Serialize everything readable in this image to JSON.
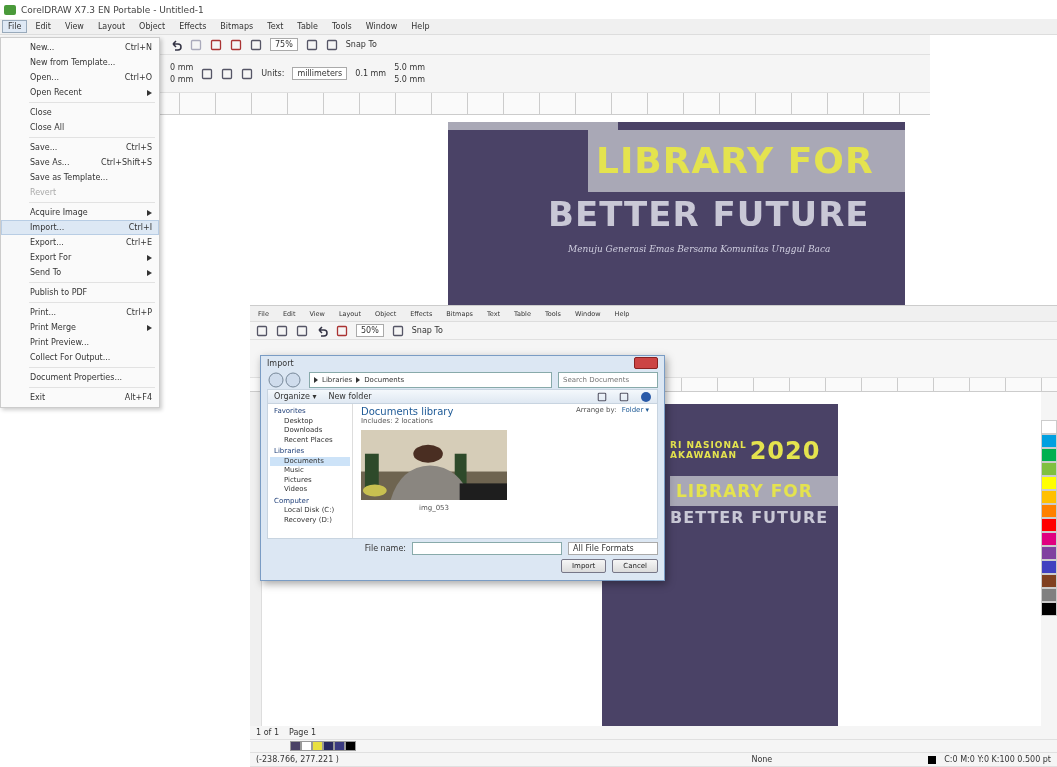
{
  "back_window": {
    "title": "CorelDRAW X7.3 EN Portable - Untitled-1",
    "menu": [
      {
        "label": "File",
        "selected": true
      },
      {
        "label": "Edit",
        "selected": false
      },
      {
        "label": "View",
        "selected": false
      },
      {
        "label": "Layout",
        "selected": false
      },
      {
        "label": "Object",
        "selected": false
      },
      {
        "label": "Effects",
        "selected": false
      },
      {
        "label": "Bitmaps",
        "selected": false
      },
      {
        "label": "Text",
        "selected": false
      },
      {
        "label": "Table",
        "selected": false
      },
      {
        "label": "Tools",
        "selected": false
      },
      {
        "label": "Window",
        "selected": false
      },
      {
        "label": "Help",
        "selected": false
      }
    ],
    "zoom": "75%",
    "snap": "Snap To",
    "width_field": "0 mm",
    "height_field": "0 mm",
    "units_label": "Units:",
    "units": "millimeters",
    "nudge": "0.1 mm",
    "dup_x": "5.0 mm",
    "dup_y": "5.0 mm",
    "poster": {
      "line_1": "LIBRARY FOR",
      "line_2": "BETTER FUTURE",
      "tagline": "Menuju Generasi Emas Bersama Komunitas Unggul Baca"
    }
  },
  "file_menu": {
    "sections": [
      {
        "items": [
          {
            "label": "New...",
            "shortcut": "Ctrl+N",
            "submenu": false,
            "disabled": false,
            "selected": false
          },
          {
            "label": "New from Template...",
            "submenu": false,
            "disabled": false,
            "selected": false
          },
          {
            "label": "Open...",
            "shortcut": "Ctrl+O",
            "submenu": false,
            "disabled": false,
            "selected": false
          },
          {
            "label": "Open Recent",
            "submenu": true,
            "disabled": false,
            "selected": false
          }
        ]
      },
      {
        "items": [
          {
            "label": "Close",
            "submenu": false,
            "disabled": false,
            "selected": false
          },
          {
            "label": "Close All",
            "submenu": false,
            "disabled": false,
            "selected": false
          }
        ]
      },
      {
        "items": [
          {
            "label": "Save...",
            "shortcut": "Ctrl+S",
            "submenu": false,
            "disabled": false,
            "selected": false
          },
          {
            "label": "Save As...",
            "shortcut": "Ctrl+Shift+S",
            "submenu": false,
            "disabled": false,
            "selected": false
          },
          {
            "label": "Save as Template...",
            "submenu": false,
            "disabled": false,
            "selected": false
          },
          {
            "label": "Revert",
            "submenu": false,
            "disabled": true,
            "selected": false
          }
        ]
      },
      {
        "items": [
          {
            "label": "Acquire Image",
            "submenu": true,
            "disabled": false,
            "selected": false
          },
          {
            "label": "Import...",
            "shortcut": "Ctrl+I",
            "submenu": false,
            "disabled": false,
            "selected": true
          },
          {
            "label": "Export...",
            "shortcut": "Ctrl+E",
            "submenu": false,
            "disabled": false,
            "selected": false
          },
          {
            "label": "Export For",
            "submenu": true,
            "disabled": false,
            "selected": false
          },
          {
            "label": "Send To",
            "submenu": true,
            "disabled": false,
            "selected": false
          }
        ]
      },
      {
        "items": [
          {
            "label": "Publish to PDF",
            "submenu": false,
            "disabled": false,
            "selected": false
          }
        ]
      },
      {
        "items": [
          {
            "label": "Print...",
            "shortcut": "Ctrl+P",
            "submenu": false,
            "disabled": false,
            "selected": false
          },
          {
            "label": "Print Merge",
            "submenu": true,
            "disabled": false,
            "selected": false
          },
          {
            "label": "Print Preview...",
            "submenu": false,
            "disabled": false,
            "selected": false
          },
          {
            "label": "Collect For Output...",
            "submenu": false,
            "disabled": false,
            "selected": false
          }
        ]
      },
      {
        "items": [
          {
            "label": "Document Properties...",
            "submenu": false,
            "disabled": false,
            "selected": false
          }
        ]
      },
      {
        "items": [
          {
            "label": "Exit",
            "shortcut": "Alt+F4",
            "submenu": false,
            "disabled": false,
            "selected": false
          }
        ]
      }
    ]
  },
  "front_window": {
    "menu": [
      {
        "label": "File",
        "selected": false
      },
      {
        "label": "Edit",
        "selected": false
      },
      {
        "label": "View",
        "selected": false
      },
      {
        "label": "Layout",
        "selected": false
      },
      {
        "label": "Object",
        "selected": false
      },
      {
        "label": "Effects",
        "selected": false
      },
      {
        "label": "Bitmaps",
        "selected": false
      },
      {
        "label": "Text",
        "selected": false
      },
      {
        "label": "Table",
        "selected": false
      },
      {
        "label": "Tools",
        "selected": false
      },
      {
        "label": "Window",
        "selected": false
      },
      {
        "label": "Help",
        "selected": false
      }
    ],
    "zoom": "50%",
    "snap": "Snap To",
    "poster": {
      "line_1": "RI NASIONAL",
      "line_2": "AKAWANAN",
      "year": "2020",
      "line_3": "LIBRARY FOR",
      "line_4": "BETTER FUTURE"
    },
    "palette": [
      {
        "color": "#ffffff"
      },
      {
        "color": "#00a0e0"
      },
      {
        "color": "#00b050"
      },
      {
        "color": "#80c040"
      },
      {
        "color": "#ffff00"
      },
      {
        "color": "#ffc000"
      },
      {
        "color": "#ff8000"
      },
      {
        "color": "#ff0000"
      },
      {
        "color": "#e00080"
      },
      {
        "color": "#8040a0"
      },
      {
        "color": "#4040c0"
      },
      {
        "color": "#804020"
      },
      {
        "color": "#808080"
      },
      {
        "color": "#000000"
      }
    ],
    "page_count": "1 of 1",
    "page_tab": "Page 1",
    "doc_palette": [
      {
        "color": "#4a4266"
      },
      {
        "color": "#ffffff"
      },
      {
        "color": "#e8e040"
      },
      {
        "color": "#2a2a60"
      },
      {
        "color": "#3a3a80"
      },
      {
        "color": "#000000"
      }
    ],
    "coordinates": "(-238.766, 277.221 )",
    "fill_status": "None",
    "outline_status": "C:0 M:0 Y:0 K:100 0.500 pt"
  },
  "import_dialog": {
    "title": "Import",
    "path": [
      "Libraries",
      "Documents"
    ],
    "search_placeholder": "Search Documents",
    "organize": "Organize ▾",
    "new_folder": "New folder",
    "nav": [
      {
        "label": "Favorites",
        "selected": false,
        "children": [
          {
            "label": "Desktop",
            "selected": false
          },
          {
            "label": "Downloads",
            "selected": false
          },
          {
            "label": "Recent Places",
            "selected": false
          }
        ]
      },
      {
        "label": "Libraries",
        "selected": false,
        "children": [
          {
            "label": "Documents",
            "selected": true
          },
          {
            "label": "Music",
            "selected": false
          },
          {
            "label": "Pictures",
            "selected": false
          },
          {
            "label": "Videos",
            "selected": false
          }
        ]
      },
      {
        "label": "Computer",
        "selected": false,
        "children": [
          {
            "label": "Local Disk (C:)",
            "selected": false
          },
          {
            "label": "Recovery (D:)",
            "selected": false
          }
        ]
      }
    ],
    "library_title": "Documents library",
    "library_sub": "Includes: 2 locations",
    "arrange_label": "Arrange by:",
    "arrange_value": "Folder ▾",
    "files": [
      {
        "name": "img_053",
        "kind": "picture"
      }
    ],
    "file_name_label": "File name:",
    "file_type": "All File Formats",
    "buttons": [
      "Import",
      "Cancel"
    ]
  }
}
